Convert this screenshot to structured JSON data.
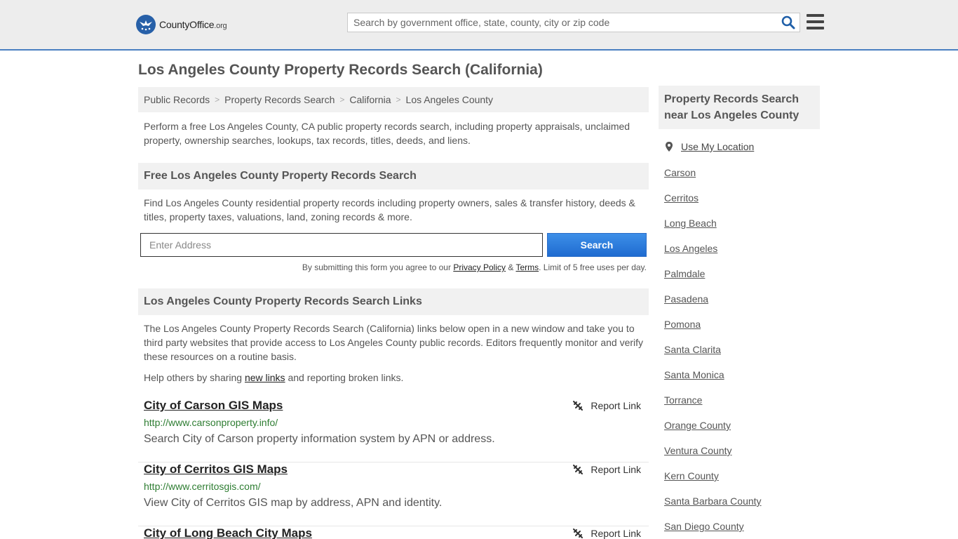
{
  "header": {
    "logo_main": "County",
    "logo_office": "Office",
    "logo_tld": ".org",
    "search_placeholder": "Search by government office, state, county, city or zip code"
  },
  "page_title": "Los Angeles County Property Records Search (California)",
  "breadcrumb": [
    "Public Records",
    "Property Records Search",
    "California",
    "Los Angeles County"
  ],
  "intro": "Perform a free Los Angeles County, CA public property records search, including property appraisals, unclaimed property, ownership searches, lookups, tax records, titles, deeds, and liens.",
  "free_search": {
    "heading": "Free Los Angeles County Property Records Search",
    "description": "Find Los Angeles County residential property records including property owners, sales & transfer history, deeds & titles, property taxes, valuations, land, zoning records & more.",
    "address_placeholder": "Enter Address",
    "button_label": "Search",
    "disclaimer_pre": "By submitting this form you agree to our ",
    "privacy_label": "Privacy Policy",
    "amp": " & ",
    "terms_label": "Terms",
    "disclaimer_post": ". Limit of 5 free uses per day."
  },
  "links_section": {
    "heading": "Los Angeles County Property Records Search Links",
    "description": "The Los Angeles County Property Records Search (California) links below open in a new window and take you to third party websites that provide access to Los Angeles County public records. Editors frequently monitor and verify these resources on a routine basis.",
    "help_pre": "Help others by sharing ",
    "help_link": "new links",
    "help_post": " and reporting broken links.",
    "report_label": "Report Link",
    "records": [
      {
        "title": "City of Carson GIS Maps",
        "url": "http://www.carsonproperty.info/",
        "desc": "Search City of Carson property information system by APN or address."
      },
      {
        "title": "City of Cerritos GIS Maps",
        "url": "http://www.cerritosgis.com/",
        "desc": "View City of Cerritos GIS map by address, APN and identity."
      },
      {
        "title": "City of Long Beach City Maps",
        "url": "",
        "desc": ""
      }
    ]
  },
  "sidebar": {
    "heading": "Property Records Search near Los Angeles County",
    "use_location": "Use My Location",
    "places": [
      "Carson",
      "Cerritos",
      "Long Beach",
      "Los Angeles",
      "Palmdale",
      "Pasadena",
      "Pomona",
      "Santa Clarita",
      "Santa Monica",
      "Torrance",
      "Orange County",
      "Ventura County",
      "Kern County",
      "Santa Barbara County",
      "San Diego County"
    ]
  }
}
